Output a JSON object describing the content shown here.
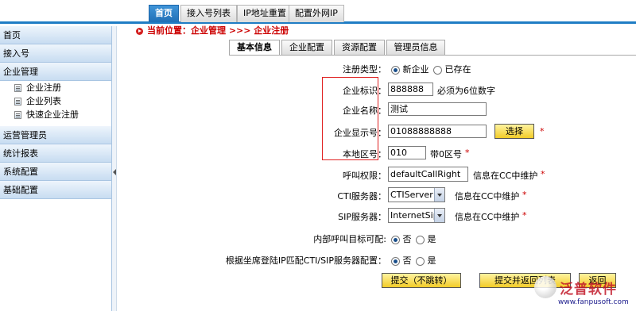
{
  "top_tabs": [
    "首页",
    "接入号列表",
    "IP地址重置",
    "配置外网IP"
  ],
  "sidebar": {
    "sections": [
      "首页",
      "接入号",
      "企业管理",
      "运营管理员",
      "统计报表",
      "系统配置",
      "基础配置"
    ],
    "sub_items": [
      "企业注册",
      "企业列表",
      "快速企业注册"
    ]
  },
  "breadcrumb": "当前位置：企业管理 >>> 企业注册",
  "tabs": [
    "基本信息",
    "企业配置",
    "资源配置",
    "管理员信息"
  ],
  "form": {
    "reg_type": {
      "label": "注册类型：",
      "options": [
        "新企业",
        "已存在"
      ]
    },
    "corp_id": {
      "label": "企业标识：",
      "value": "888888",
      "note": "必须为6位数字"
    },
    "corp_name": {
      "label": "企业名称：",
      "value": "测试"
    },
    "corp_display": {
      "label": "企业显示号：",
      "value": "01088888888",
      "button": "选择",
      "required": "*"
    },
    "area_code": {
      "label": "本地区号：",
      "value": "010",
      "note": "带0区号",
      "required": "*"
    },
    "call_perm": {
      "label": "呼叫权限：",
      "value": "defaultCallRight",
      "note": "信息在CC中维护",
      "required": "*"
    },
    "cti": {
      "label": "CTI服务器：",
      "value": "CTIServer",
      "note": "信息在CC中维护",
      "required": "*"
    },
    "sip": {
      "label": "SIP服务器：",
      "value": "InternetSip",
      "note": "信息在CC中维护",
      "required": "*"
    },
    "internal_call": {
      "label": "内部呼叫目标可配:",
      "options": [
        "否",
        "是"
      ]
    },
    "ip_match": {
      "label": "根据坐席登陆IP匹配CTI/SIP服务器配置：",
      "options": [
        "否",
        "是"
      ]
    }
  },
  "buttons": [
    "提交（不跳转）",
    "提交并返回列表",
    "返回"
  ],
  "watermark": {
    "text": "泛普软件",
    "url": "www.fanpusoft.com"
  }
}
